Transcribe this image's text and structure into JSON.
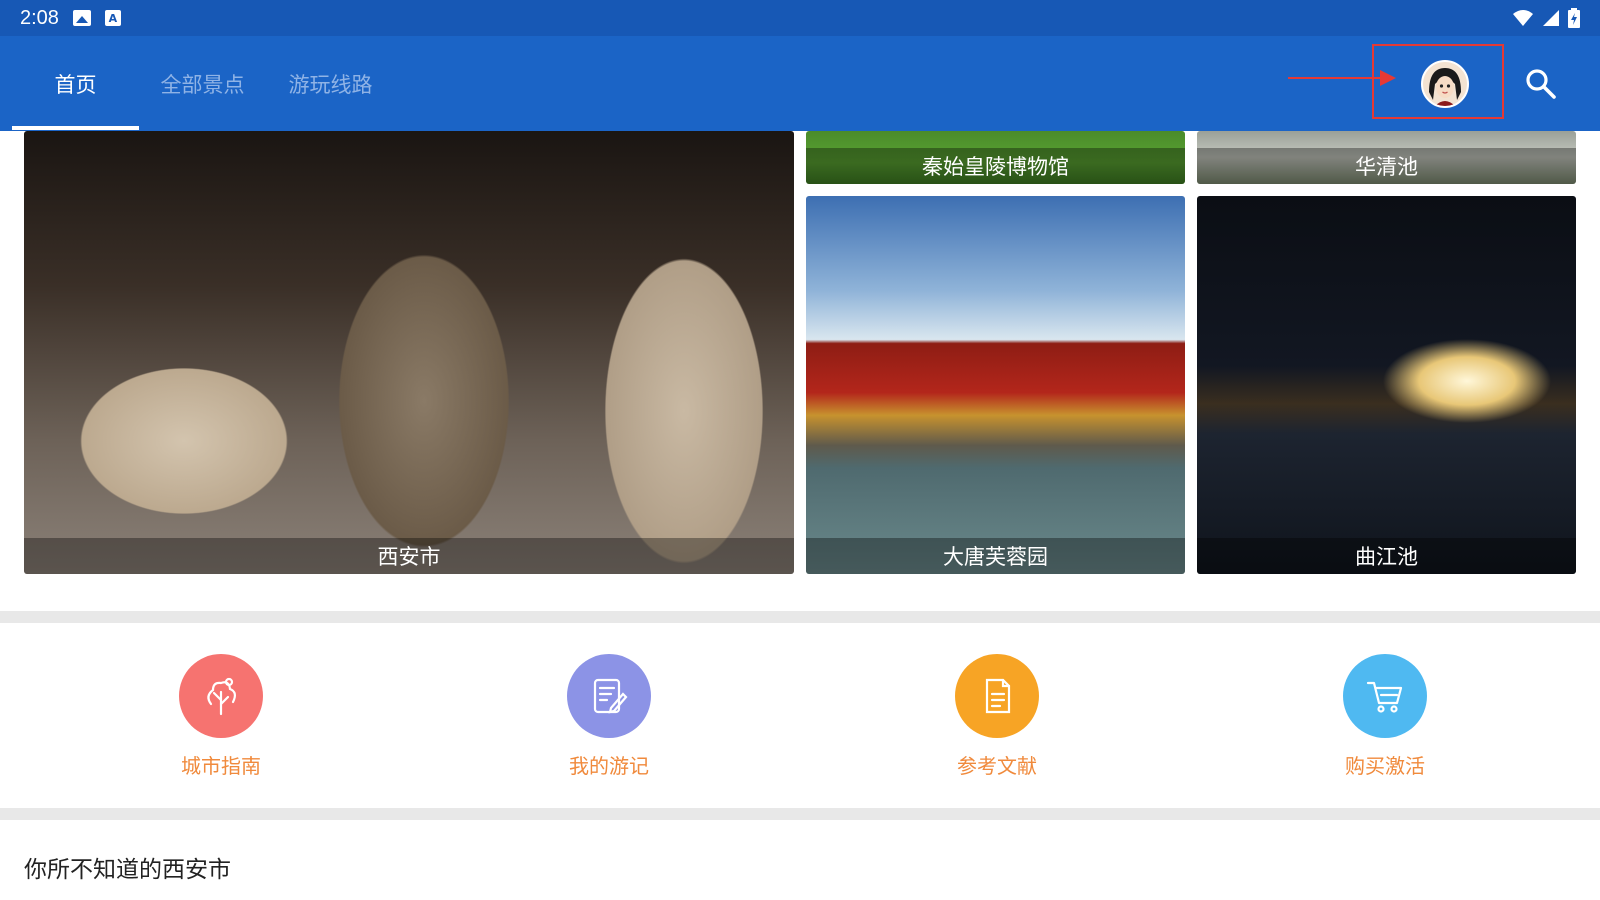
{
  "status_bar": {
    "time": "2:08",
    "icons": [
      "image-icon",
      "text-a-icon",
      "wifi-icon",
      "signal-icon",
      "battery-icon"
    ]
  },
  "tabs": [
    {
      "label": "首页",
      "active": true
    },
    {
      "label": "全部景点",
      "active": false
    },
    {
      "label": "游玩线路",
      "active": false
    }
  ],
  "header": {
    "avatar_icon": "user-avatar-icon",
    "search_icon": "search-icon",
    "annotation_color": "#e53935"
  },
  "tiles": {
    "xian": "西安市",
    "qin": "秦始皇陵博物馆",
    "huaqing": "华清池",
    "datang": "大唐芙蓉园",
    "qujiang": "曲江池"
  },
  "shortcuts": [
    {
      "label": "城市指南",
      "color": "#f67370",
      "icon": "tree-icon"
    },
    {
      "label": "我的游记",
      "color": "#8c93e6",
      "icon": "notes-icon"
    },
    {
      "label": "参考文献",
      "color": "#f7a425",
      "icon": "document-icon"
    },
    {
      "label": "购买激活",
      "color": "#4fb9f1",
      "icon": "cart-icon"
    }
  ],
  "section": {
    "title": "你所不知道的西安市"
  },
  "colors": {
    "primary": "#1b64c6",
    "status_bar": "#1758b5",
    "shortcut_label": "#f08a3c"
  }
}
